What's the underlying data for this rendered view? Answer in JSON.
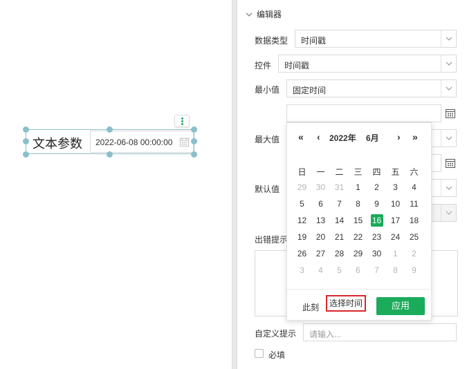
{
  "canvas": {
    "widget": {
      "label": "文本参数",
      "value": "2022-06-08 00:00:00"
    }
  },
  "panel": {
    "section_title": "编辑器",
    "rows": {
      "data_type": {
        "label": "数据类型",
        "value": "时间戳"
      },
      "control": {
        "label": "控件",
        "value": "时间戳"
      },
      "min": {
        "label": "最小值",
        "value": "固定时间"
      },
      "max": {
        "label": "最大值"
      },
      "default": {
        "label": "默认值"
      },
      "error_tip": {
        "label": "出错提示"
      },
      "custom_tip": {
        "label": "自定义提示",
        "placeholder": "请输入..."
      },
      "required": {
        "label": "必填"
      }
    }
  },
  "datepicker": {
    "year_label": "2022年",
    "month_label": "6月",
    "nav": {
      "prev_year": "«",
      "prev_month": "‹",
      "next_month": "›",
      "next_year": "»"
    },
    "weekdays": [
      "日",
      "一",
      "二",
      "三",
      "四",
      "五",
      "六"
    ],
    "weeks": [
      [
        "29",
        "30",
        "31",
        "1",
        "2",
        "3",
        "4"
      ],
      [
        "5",
        "6",
        "7",
        "8",
        "9",
        "10",
        "11"
      ],
      [
        "12",
        "13",
        "14",
        "15",
        "16",
        "17",
        "18"
      ],
      [
        "19",
        "20",
        "21",
        "22",
        "23",
        "24",
        "25"
      ],
      [
        "26",
        "27",
        "28",
        "29",
        "30",
        "1",
        "2"
      ],
      [
        "3",
        "4",
        "5",
        "6",
        "7",
        "8",
        "9"
      ]
    ],
    "selected_day": "16",
    "now_label": "此刻",
    "pick_time_label": "选择时间",
    "apply_label": "应用"
  },
  "colors": {
    "accent": "#1aab5b",
    "highlight_border": "#d9252c",
    "selection_handles": "#8bbfcc"
  }
}
